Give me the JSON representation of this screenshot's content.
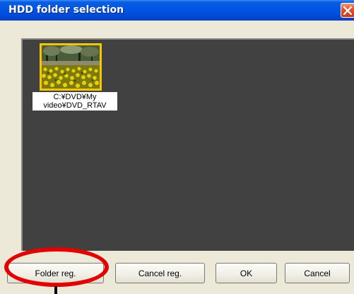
{
  "window": {
    "title": "HDD folder selection"
  },
  "folders": [
    {
      "path_line1": "C:¥DVD¥My",
      "path_line2": "video¥DVD_RTAV"
    }
  ],
  "buttons": {
    "folder_reg": "Folder reg.",
    "cancel_reg": "Cancel reg.",
    "ok": "OK",
    "cancel": "Cancel"
  },
  "colors": {
    "titlebar": "#0055e5",
    "panel": "#414141",
    "selection_border": "#f7c600",
    "highlight_annotation": "#e30000"
  },
  "icons": {
    "close": "close-icon"
  }
}
